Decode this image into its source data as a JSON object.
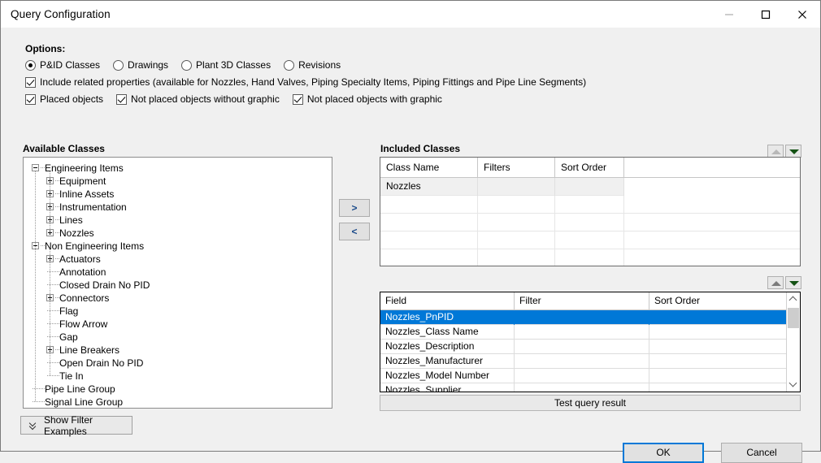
{
  "window": {
    "title": "Query Configuration",
    "caption_buttons": [
      {
        "name": "minimize",
        "glyph": "—"
      },
      {
        "name": "maximize",
        "glyph": "☐"
      },
      {
        "name": "close",
        "glyph": "✕"
      }
    ]
  },
  "options": {
    "title": "Options:",
    "radios": [
      {
        "label": "P&ID Classes",
        "checked": true
      },
      {
        "label": "Drawings",
        "checked": false
      },
      {
        "label": "Plant 3D Classes",
        "checked": false
      },
      {
        "label": "Revisions",
        "checked": false
      }
    ],
    "include_related": {
      "label": "Include related properties (available for Nozzles, Hand Valves, Piping Specialty Items, Piping Fittings and Pipe Line Segments)",
      "checked": true
    },
    "placement_checks": [
      {
        "label": "Placed objects",
        "checked": true
      },
      {
        "label": "Not placed objects without graphic",
        "checked": true
      },
      {
        "label": "Not placed objects with graphic",
        "checked": true
      }
    ]
  },
  "available": {
    "caption": "Available Classes",
    "nodes": [
      {
        "label": "Engineering Items",
        "depth": 0,
        "toggle": "minus"
      },
      {
        "label": "Equipment",
        "depth": 1,
        "toggle": "plus"
      },
      {
        "label": "Inline Assets",
        "depth": 1,
        "toggle": "plus"
      },
      {
        "label": "Instrumentation",
        "depth": 1,
        "toggle": "plus"
      },
      {
        "label": "Lines",
        "depth": 1,
        "toggle": "plus"
      },
      {
        "label": "Nozzles",
        "depth": 1,
        "toggle": "plus"
      },
      {
        "label": "Non Engineering Items",
        "depth": 0,
        "toggle": "minus"
      },
      {
        "label": "Actuators",
        "depth": 1,
        "toggle": "plus"
      },
      {
        "label": "Annotation",
        "depth": 1,
        "toggle": "none"
      },
      {
        "label": "Closed Drain No PID",
        "depth": 1,
        "toggle": "none"
      },
      {
        "label": "Connectors",
        "depth": 1,
        "toggle": "plus"
      },
      {
        "label": "Flag",
        "depth": 1,
        "toggle": "none"
      },
      {
        "label": "Flow Arrow",
        "depth": 1,
        "toggle": "none"
      },
      {
        "label": "Gap",
        "depth": 1,
        "toggle": "none"
      },
      {
        "label": "Line Breakers",
        "depth": 1,
        "toggle": "plus"
      },
      {
        "label": "Open Drain No PID",
        "depth": 1,
        "toggle": "none"
      },
      {
        "label": "Tie In",
        "depth": 1,
        "toggle": "none"
      },
      {
        "label": "Pipe Line Group",
        "depth": 0,
        "toggle": "none"
      },
      {
        "label": "Signal Line Group",
        "depth": 0,
        "toggle": "none"
      }
    ]
  },
  "transfer": {
    "add_label": ">",
    "remove_label": "<"
  },
  "included": {
    "caption": "Included Classes",
    "columns": [
      "Class Name",
      "Filters",
      "Sort Order"
    ],
    "rows": [
      {
        "class_name": "Nozzles",
        "filters": "",
        "sort_order": "",
        "selected": true
      },
      {
        "class_name": "",
        "filters": "",
        "sort_order": "",
        "selected": false
      },
      {
        "class_name": "",
        "filters": "",
        "sort_order": "",
        "selected": false
      },
      {
        "class_name": "",
        "filters": "",
        "sort_order": "",
        "selected": false
      },
      {
        "class_name": "",
        "filters": "",
        "sort_order": "",
        "selected": false
      }
    ],
    "reorder": {
      "up_enabled": false,
      "down_enabled": true
    }
  },
  "fields": {
    "columns": [
      "Field",
      "Filter",
      "Sort Order"
    ],
    "rows": [
      {
        "field": "Nozzles_PnPID",
        "filter": "",
        "sort_order": "",
        "selected": true
      },
      {
        "field": "Nozzles_Class Name",
        "filter": "",
        "sort_order": "",
        "selected": false
      },
      {
        "field": "Nozzles_Description",
        "filter": "",
        "sort_order": "",
        "selected": false
      },
      {
        "field": "Nozzles_Manufacturer",
        "filter": "",
        "sort_order": "",
        "selected": false
      },
      {
        "field": "Nozzles_Model Number",
        "filter": "",
        "sort_order": "",
        "selected": false
      },
      {
        "field": "Nozzles_Supplier",
        "filter": "",
        "sort_order": "",
        "selected": false
      }
    ],
    "reorder": {
      "up_enabled": true,
      "down_enabled": true
    }
  },
  "buttons": {
    "test_query": "Test query result",
    "show_filter_examples": "Show Filter Examples",
    "ok": "OK",
    "cancel": "Cancel"
  },
  "colors": {
    "selection_blue": "#0078d7",
    "dialog_bg": "#f0f0f0",
    "titlebar_bg": "#ffffff",
    "down_arrow_green": "#145214"
  }
}
